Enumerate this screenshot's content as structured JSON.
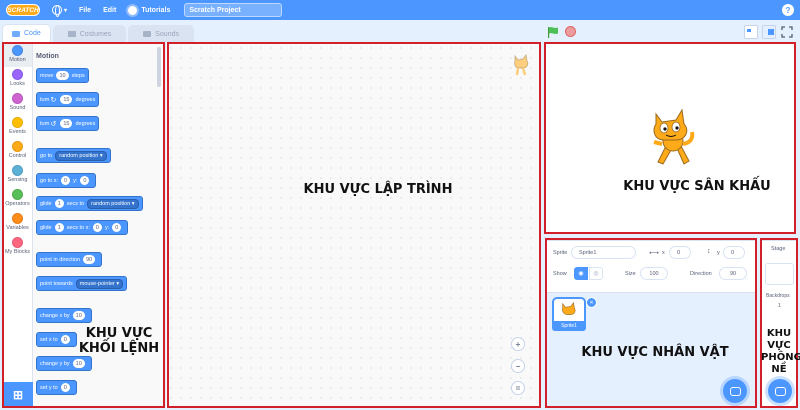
{
  "menubar": {
    "logo": "SCRATCH",
    "file": "File",
    "edit": "Edit",
    "tutorials": "Tutorials",
    "project_title": "Scratch Project",
    "help": "?"
  },
  "tabs": [
    {
      "label": "Code"
    },
    {
      "label": "Costumes"
    },
    {
      "label": "Sounds"
    }
  ],
  "categories": [
    {
      "label": "Motion",
      "color": "#4c97ff"
    },
    {
      "label": "Looks",
      "color": "#9966ff"
    },
    {
      "label": "Sound",
      "color": "#cf63cf"
    },
    {
      "label": "Events",
      "color": "#ffbf00"
    },
    {
      "label": "Control",
      "color": "#ffab19"
    },
    {
      "label": "Sensing",
      "color": "#5cb1d6"
    },
    {
      "label": "Operators",
      "color": "#59c059"
    },
    {
      "label": "Variables",
      "color": "#ff8c1a"
    },
    {
      "label": "My Blocks",
      "color": "#ff6680"
    }
  ],
  "palette": {
    "title": "Motion",
    "blocks": {
      "move": {
        "a": "move",
        "v": "10",
        "b": "steps"
      },
      "turn_right": {
        "a": "turn",
        "v": "15",
        "b": "degrees"
      },
      "turn_left": {
        "a": "turn",
        "v": "15",
        "b": "degrees"
      },
      "goto": {
        "a": "go to",
        "d": "random position"
      },
      "goto_xy": {
        "a": "go to x:",
        "v1": "0",
        "b": "y:",
        "v2": "0"
      },
      "glide": {
        "a": "glide",
        "v": "1",
        "b": "secs to",
        "d": "random position"
      },
      "glide_xy": {
        "a": "glide",
        "v": "1",
        "b": "secs to x:",
        "v1": "0",
        "c": "y:",
        "v2": "0"
      },
      "point_dir": {
        "a": "point in direction",
        "v": "90"
      },
      "point_towards": {
        "a": "point towards",
        "d": "mouse-pointer"
      },
      "change_x": {
        "a": "change x by",
        "v": "10"
      },
      "set_x": {
        "a": "set x to",
        "v": "0"
      },
      "change_y": {
        "a": "change y by",
        "v": "10"
      },
      "set_y": {
        "a": "set y to",
        "v": "0"
      }
    }
  },
  "sprite_info": {
    "sprite_label": "Sprite",
    "sprite_name": "Sprite1",
    "x_label": "x",
    "x": "0",
    "y_label": "y",
    "y": "0",
    "show_label": "Show",
    "size_label": "Size",
    "size": "100",
    "direction_label": "Direction",
    "direction": "90"
  },
  "sprite_list": [
    {
      "name": "Sprite1"
    }
  ],
  "stage_panel": {
    "title": "Stage",
    "backdrops_label": "Backdrops",
    "backdrops_count": "1"
  },
  "annotations": {
    "code_area": "KHU VỰC LẬP TRÌNH",
    "stage": "KHU VỰC SÂN KHẤU",
    "blocks_line1": "KHU VỰC",
    "blocks_line2": "KHỐI LỆNH",
    "sprites": "KHU VỰC NHÂN VẬT",
    "backdrop_1": "KHU",
    "backdrop_2": "VỰC",
    "backdrop_3": "PHÔNG",
    "backdrop_4": "NỀ"
  },
  "colors": {
    "accent": "#4c97ff",
    "annotation_border": "#d1202a",
    "flag": "#4cbf56",
    "stop": "#ec9c9c"
  }
}
